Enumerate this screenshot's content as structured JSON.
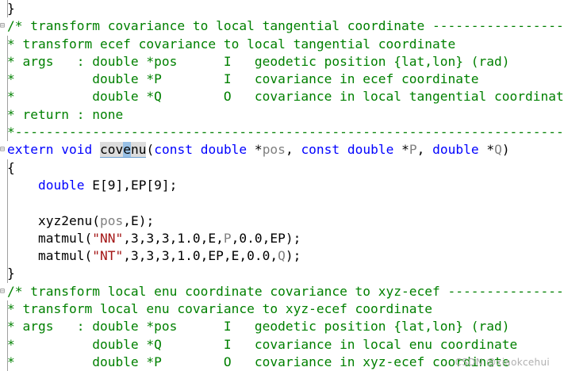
{
  "editor": {
    "lines": [
      {
        "text": "}",
        "kind": "plain",
        "fold": ""
      },
      {
        "text": "/* transform covariance to local tangential coordinate --------------------------",
        "kind": "comment",
        "fold": "⊟"
      },
      {
        "text": "* transform ecef covariance to local tangential coordinate",
        "kind": "comment",
        "fold": ""
      },
      {
        "text": "* args   : double *pos      I   geodetic position {lat,lon} (rad)",
        "kind": "comment",
        "fold": ""
      },
      {
        "text": "*          double *P        I   covariance in ecef coordinate",
        "kind": "comment",
        "fold": ""
      },
      {
        "text": "*          double *Q        O   covariance in local tangential coordinate",
        "kind": "comment",
        "fold": ""
      },
      {
        "text": "* return : none",
        "kind": "comment",
        "fold": ""
      },
      {
        "text": "*-------------------------------------------------------------------------------",
        "kind": "comment",
        "fold": ""
      },
      {
        "text": "",
        "kind": "signature",
        "fold": "⊟"
      },
      {
        "text": "{",
        "kind": "plain",
        "fold": ""
      },
      {
        "text": "",
        "kind": "decl",
        "fold": ""
      },
      {
        "text": "",
        "kind": "blank",
        "fold": ""
      },
      {
        "text": "",
        "kind": "call1",
        "fold": ""
      },
      {
        "text": "",
        "kind": "call2",
        "fold": ""
      },
      {
        "text": "",
        "kind": "call3",
        "fold": ""
      },
      {
        "text": "}",
        "kind": "plain",
        "fold": ""
      },
      {
        "text": "/* transform local enu coordinate covariance to xyz-ecef --------------------------",
        "kind": "comment",
        "fold": "⊟"
      },
      {
        "text": "* transform local enu covariance to xyz-ecef coordinate",
        "kind": "comment",
        "fold": ""
      },
      {
        "text": "* args   : double *pos      I   geodetic position {lat,lon} (rad)",
        "kind": "comment",
        "fold": ""
      },
      {
        "text": "*          double *Q        I   covariance in local enu coordinate",
        "kind": "comment",
        "fold": ""
      },
      {
        "text": "*          double *P        O   covariance in xyz-ecef coordinate",
        "kind": "comment",
        "fold": ""
      }
    ],
    "signature": {
      "kw_extern": "extern",
      "kw_void": "void",
      "fn_prefix": "cov",
      "fn_cursor": "e",
      "fn_suffix": "nu",
      "open": "(",
      "kw_const1": "const",
      "kw_double1": "double",
      "star1": " *",
      "p1": "pos",
      "comma1": ", ",
      "kw_const2": "const",
      "kw_double2": "double",
      "star2": " *",
      "p2": "P",
      "comma2": ", ",
      "kw_double3": "double",
      "star3": " *",
      "p3": "Q",
      "close": ")"
    },
    "decl": {
      "indent": "    ",
      "kw_double": "double",
      "rest": " E[9],EP[9];"
    },
    "call1": {
      "indent": "    ",
      "fn": "xyz2enu",
      "open": "(",
      "arg1": "pos",
      "rest": ",E);"
    },
    "call2": {
      "indent": "    ",
      "fn": "matmul",
      "open": "(",
      "str": "\"NN\"",
      "mid": ",3,3,3,1.0,E,",
      "argP": "P",
      "end": ",0.0,EP);"
    },
    "call3": {
      "indent": "    ",
      "fn": "matmul",
      "open": "(",
      "str": "\"NT\"",
      "mid": ",3,3,3,1.0,EP,E,0.0,",
      "argQ": "Q",
      "end": ");"
    }
  },
  "watermark": "CSDN @xiaokcehui",
  "colors": {
    "comment": "#008000",
    "keyword": "#0000ff",
    "string": "#a31515",
    "param": "#808080"
  }
}
